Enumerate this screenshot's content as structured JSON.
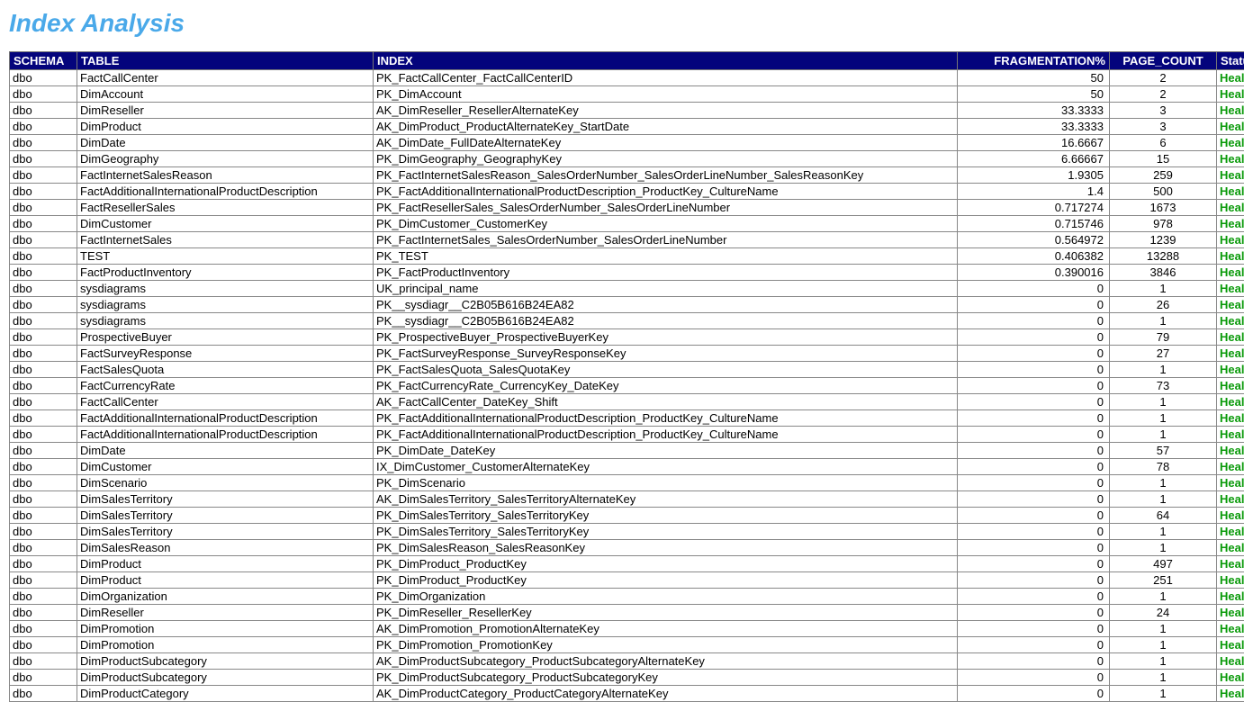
{
  "title": "Index Analysis",
  "columns": {
    "schema": "SCHEMA",
    "table": "TABLE",
    "index": "INDEX",
    "fragmentation": "FRAGMENTATION%",
    "page_count": "PAGE_COUNT",
    "status": "Status"
  },
  "rows": [
    {
      "schema": "dbo",
      "table": "FactCallCenter",
      "index": "PK_FactCallCenter_FactCallCenterID",
      "frag": "50",
      "page": "2",
      "status": "Healthy"
    },
    {
      "schema": "dbo",
      "table": "DimAccount",
      "index": "PK_DimAccount",
      "frag": "50",
      "page": "2",
      "status": "Healthy"
    },
    {
      "schema": "dbo",
      "table": "DimReseller",
      "index": "AK_DimReseller_ResellerAlternateKey",
      "frag": "33.3333",
      "page": "3",
      "status": "Healthy"
    },
    {
      "schema": "dbo",
      "table": "DimProduct",
      "index": "AK_DimProduct_ProductAlternateKey_StartDate",
      "frag": "33.3333",
      "page": "3",
      "status": "Healthy"
    },
    {
      "schema": "dbo",
      "table": "DimDate",
      "index": "AK_DimDate_FullDateAlternateKey",
      "frag": "16.6667",
      "page": "6",
      "status": "Healthy"
    },
    {
      "schema": "dbo",
      "table": "DimGeography",
      "index": "PK_DimGeography_GeographyKey",
      "frag": "6.66667",
      "page": "15",
      "status": "Healthy"
    },
    {
      "schema": "dbo",
      "table": "FactInternetSalesReason",
      "index": "PK_FactInternetSalesReason_SalesOrderNumber_SalesOrderLineNumber_SalesReasonKey",
      "frag": "1.9305",
      "page": "259",
      "status": "Healthy"
    },
    {
      "schema": "dbo",
      "table": "FactAdditionalInternationalProductDescription",
      "index": "PK_FactAdditionalInternationalProductDescription_ProductKey_CultureName",
      "frag": "1.4",
      "page": "500",
      "status": "Healthy"
    },
    {
      "schema": "dbo",
      "table": "FactResellerSales",
      "index": "PK_FactResellerSales_SalesOrderNumber_SalesOrderLineNumber",
      "frag": "0.717274",
      "page": "1673",
      "status": "Healthy"
    },
    {
      "schema": "dbo",
      "table": "DimCustomer",
      "index": "PK_DimCustomer_CustomerKey",
      "frag": "0.715746",
      "page": "978",
      "status": "Healthy"
    },
    {
      "schema": "dbo",
      "table": "FactInternetSales",
      "index": "PK_FactInternetSales_SalesOrderNumber_SalesOrderLineNumber",
      "frag": "0.564972",
      "page": "1239",
      "status": "Healthy"
    },
    {
      "schema": "dbo",
      "table": "TEST",
      "index": "PK_TEST",
      "frag": "0.406382",
      "page": "13288",
      "status": "Healthy"
    },
    {
      "schema": "dbo",
      "table": "FactProductInventory",
      "index": "PK_FactProductInventory",
      "frag": "0.390016",
      "page": "3846",
      "status": "Healthy"
    },
    {
      "schema": "dbo",
      "table": "sysdiagrams",
      "index": "UK_principal_name",
      "frag": "0",
      "page": "1",
      "status": "Healthy"
    },
    {
      "schema": "dbo",
      "table": "sysdiagrams",
      "index": "PK__sysdiagr__C2B05B616B24EA82",
      "frag": "0",
      "page": "26",
      "status": "Healthy"
    },
    {
      "schema": "dbo",
      "table": "sysdiagrams",
      "index": "PK__sysdiagr__C2B05B616B24EA82",
      "frag": "0",
      "page": "1",
      "status": "Healthy"
    },
    {
      "schema": "dbo",
      "table": "ProspectiveBuyer",
      "index": "PK_ProspectiveBuyer_ProspectiveBuyerKey",
      "frag": "0",
      "page": "79",
      "status": "Healthy"
    },
    {
      "schema": "dbo",
      "table": "FactSurveyResponse",
      "index": "PK_FactSurveyResponse_SurveyResponseKey",
      "frag": "0",
      "page": "27",
      "status": "Healthy"
    },
    {
      "schema": "dbo",
      "table": "FactSalesQuota",
      "index": "PK_FactSalesQuota_SalesQuotaKey",
      "frag": "0",
      "page": "1",
      "status": "Healthy"
    },
    {
      "schema": "dbo",
      "table": "FactCurrencyRate",
      "index": "PK_FactCurrencyRate_CurrencyKey_DateKey",
      "frag": "0",
      "page": "73",
      "status": "Healthy"
    },
    {
      "schema": "dbo",
      "table": "FactCallCenter",
      "index": "AK_FactCallCenter_DateKey_Shift",
      "frag": "0",
      "page": "1",
      "status": "Healthy"
    },
    {
      "schema": "dbo",
      "table": "FactAdditionalInternationalProductDescription",
      "index": "PK_FactAdditionalInternationalProductDescription_ProductKey_CultureName",
      "frag": "0",
      "page": "1",
      "status": "Healthy"
    },
    {
      "schema": "dbo",
      "table": "FactAdditionalInternationalProductDescription",
      "index": "PK_FactAdditionalInternationalProductDescription_ProductKey_CultureName",
      "frag": "0",
      "page": "1",
      "status": "Healthy"
    },
    {
      "schema": "dbo",
      "table": "DimDate",
      "index": "PK_DimDate_DateKey",
      "frag": "0",
      "page": "57",
      "status": "Healthy"
    },
    {
      "schema": "dbo",
      "table": "DimCustomer",
      "index": "IX_DimCustomer_CustomerAlternateKey",
      "frag": "0",
      "page": "78",
      "status": "Healthy"
    },
    {
      "schema": "dbo",
      "table": "DimScenario",
      "index": "PK_DimScenario",
      "frag": "0",
      "page": "1",
      "status": "Healthy"
    },
    {
      "schema": "dbo",
      "table": "DimSalesTerritory",
      "index": "AK_DimSalesTerritory_SalesTerritoryAlternateKey",
      "frag": "0",
      "page": "1",
      "status": "Healthy"
    },
    {
      "schema": "dbo",
      "table": "DimSalesTerritory",
      "index": "PK_DimSalesTerritory_SalesTerritoryKey",
      "frag": "0",
      "page": "64",
      "status": "Healthy"
    },
    {
      "schema": "dbo",
      "table": "DimSalesTerritory",
      "index": "PK_DimSalesTerritory_SalesTerritoryKey",
      "frag": "0",
      "page": "1",
      "status": "Healthy"
    },
    {
      "schema": "dbo",
      "table": "DimSalesReason",
      "index": "PK_DimSalesReason_SalesReasonKey",
      "frag": "0",
      "page": "1",
      "status": "Healthy"
    },
    {
      "schema": "dbo",
      "table": "DimProduct",
      "index": "PK_DimProduct_ProductKey",
      "frag": "0",
      "page": "497",
      "status": "Healthy"
    },
    {
      "schema": "dbo",
      "table": "DimProduct",
      "index": "PK_DimProduct_ProductKey",
      "frag": "0",
      "page": "251",
      "status": "Healthy"
    },
    {
      "schema": "dbo",
      "table": "DimOrganization",
      "index": "PK_DimOrganization",
      "frag": "0",
      "page": "1",
      "status": "Healthy"
    },
    {
      "schema": "dbo",
      "table": "DimReseller",
      "index": "PK_DimReseller_ResellerKey",
      "frag": "0",
      "page": "24",
      "status": "Healthy"
    },
    {
      "schema": "dbo",
      "table": "DimPromotion",
      "index": "AK_DimPromotion_PromotionAlternateKey",
      "frag": "0",
      "page": "1",
      "status": "Healthy"
    },
    {
      "schema": "dbo",
      "table": "DimPromotion",
      "index": "PK_DimPromotion_PromotionKey",
      "frag": "0",
      "page": "1",
      "status": "Healthy"
    },
    {
      "schema": "dbo",
      "table": "DimProductSubcategory",
      "index": "AK_DimProductSubcategory_ProductSubcategoryAlternateKey",
      "frag": "0",
      "page": "1",
      "status": "Healthy"
    },
    {
      "schema": "dbo",
      "table": "DimProductSubcategory",
      "index": "PK_DimProductSubcategory_ProductSubcategoryKey",
      "frag": "0",
      "page": "1",
      "status": "Healthy"
    },
    {
      "schema": "dbo",
      "table": "DimProductCategory",
      "index": "AK_DimProductCategory_ProductCategoryAlternateKey",
      "frag": "0",
      "page": "1",
      "status": "Healthy"
    }
  ]
}
